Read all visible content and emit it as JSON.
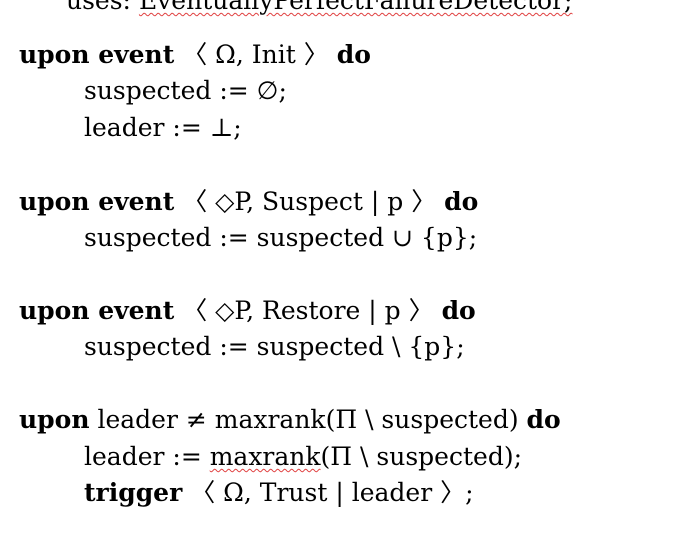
{
  "header": {
    "uses_prefix": "uses: ",
    "uses_name": "EventuallyPerfectFailureDetector;"
  },
  "block_init": {
    "kw": "upon event",
    "args": " 〈 Ω, Init 〉 ",
    "do": "do",
    "line1": "suspected := ∅;",
    "line2": "leader := ⊥;"
  },
  "block_suspect": {
    "kw": "upon event",
    "args": " 〈 ◇P, Suspect | p 〉 ",
    "do": "do",
    "line1": "suspected := suspected ∪ {p};"
  },
  "block_restore": {
    "kw": "upon event",
    "args": " 〈 ◇P, Restore | p 〉 ",
    "do": "do",
    "line1": "suspected := suspected \\ {p};"
  },
  "block_leader": {
    "kw": "upon",
    "cond": " leader ≠ maxrank(Π \\ suspected) ",
    "do": "do",
    "line1_prefix": "leader := ",
    "line1_fn": "maxrank",
    "line1_suffix": "(Π \\ suspected);",
    "trigger_kw": "trigger",
    "trigger_args": " 〈 Ω, Trust | leader 〉;"
  }
}
